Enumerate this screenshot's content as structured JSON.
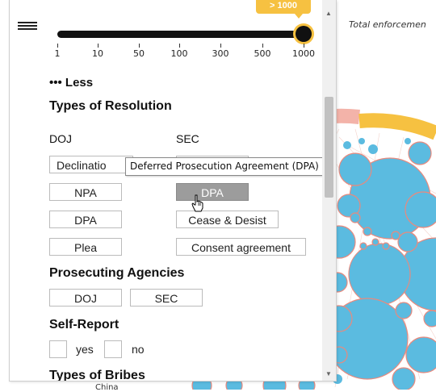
{
  "page": {
    "total_label": "Total enforcemen"
  },
  "slider": {
    "value_label": "> 1000",
    "ticks": [
      "1",
      "10",
      "50",
      "100",
      "300",
      "500",
      "1000"
    ]
  },
  "panel": {
    "less_label": "••• Less",
    "resolution_title": "Types of Resolution",
    "doj_col": "DOJ",
    "sec_col": "SEC",
    "doj_options": [
      "Declinatio",
      "NPA",
      "DPA",
      "Plea"
    ],
    "sec_options": [
      "",
      "DPA",
      "Cease & Desist",
      "Consent agreement"
    ],
    "tooltip": "Deferred Prosecution Agreement (DPA)",
    "agencies_title": "Prosecuting Agencies",
    "agency_options": [
      "DOJ",
      "SEC"
    ],
    "self_report_title": "Self-Report",
    "self_report_yes": "yes",
    "self_report_no": "no",
    "bribes_title": "Types of Bribes",
    "bottom_fragment": "China"
  },
  "colors": {
    "accent": "#f6c141",
    "bubble": "#5bbbe0",
    "bubble_stroke": "#e88a7e",
    "selected": "#9c9c9c",
    "ring_pink": "#f3b3a9"
  },
  "icons": {
    "menu": "hamburger-menu-icon",
    "cursor": "hand-pointer-icon"
  }
}
